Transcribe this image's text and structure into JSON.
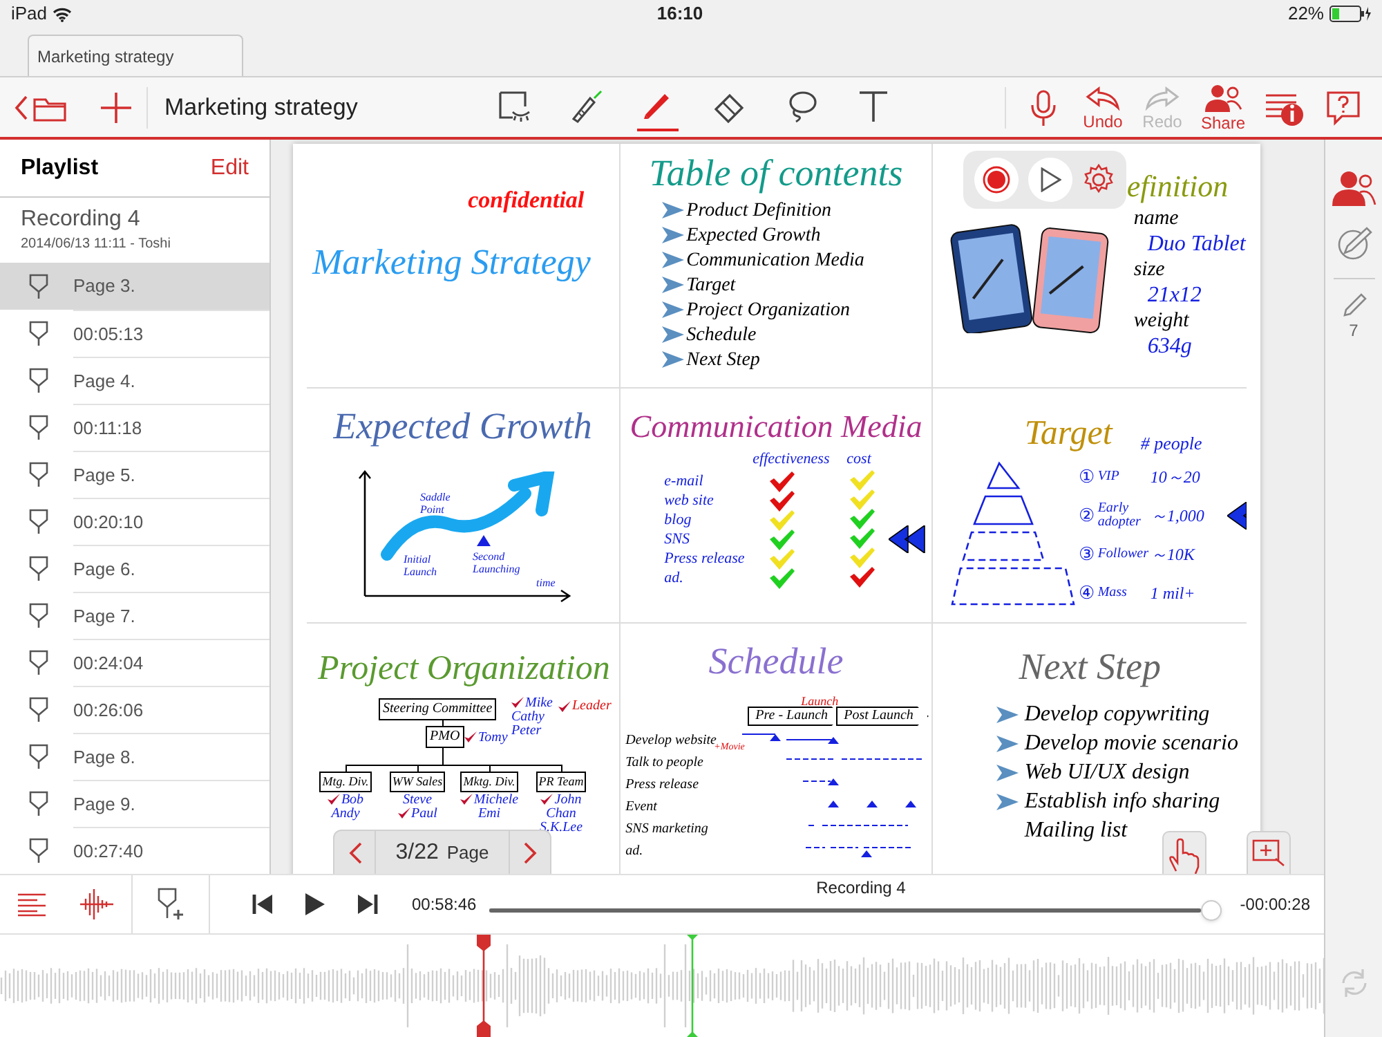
{
  "status_bar": {
    "device": "iPad",
    "time": "16:10",
    "battery": "22%"
  },
  "tabs": [
    {
      "label": "Marketing strategy",
      "selected": true
    }
  ],
  "toolbar": {
    "title": "Marketing strategy",
    "tools": [
      {
        "kind": "select",
        "selected": false
      },
      {
        "kind": "laser",
        "selected": false
      },
      {
        "kind": "pen",
        "selected": true
      },
      {
        "kind": "eraser",
        "selected": false
      },
      {
        "kind": "lasso",
        "selected": false
      },
      {
        "kind": "text",
        "selected": false
      }
    ],
    "actions": [
      {
        "kind": "mic",
        "disabled": false
      },
      {
        "kind": "undo",
        "label": "Undo",
        "disabled": false
      },
      {
        "kind": "redo",
        "label": "Redo",
        "disabled": true
      },
      {
        "kind": "share",
        "label": "Share",
        "disabled": false
      },
      {
        "kind": "info",
        "disabled": false
      },
      {
        "kind": "help",
        "disabled": false
      }
    ]
  },
  "playlist": {
    "title": "Playlist",
    "edit": "Edit",
    "recording": "Recording 4",
    "meta": "2014/06/13 11:11 - Toshi",
    "items": [
      {
        "label": "Page 3.",
        "selected": true
      },
      {
        "label": "00:05:13",
        "selected": false
      },
      {
        "label": "Page 4.",
        "selected": false
      },
      {
        "label": "00:11:18",
        "selected": false
      },
      {
        "label": "Page 5.",
        "selected": false
      },
      {
        "label": "00:20:10",
        "selected": false
      },
      {
        "label": "Page 6.",
        "selected": false
      },
      {
        "label": "Page 7.",
        "selected": false
      },
      {
        "label": "00:24:04",
        "selected": false
      },
      {
        "label": "00:26:06",
        "selected": false
      },
      {
        "label": "Page 8.",
        "selected": false
      },
      {
        "label": "Page 9.",
        "selected": false
      },
      {
        "label": "00:27:40",
        "selected": false
      }
    ]
  },
  "page": {
    "cells": [
      {
        "kind": "cover",
        "stamp": "confidential",
        "title": "Marketing Strategy"
      },
      {
        "kind": "bullets",
        "title": "Table of contents",
        "items": [
          {
            "text": "Product Definition",
            "bullet": true
          },
          {
            "text": "Expected Growth",
            "bullet": true
          },
          {
            "text": "Communication Media",
            "bullet": true
          },
          {
            "text": "Target",
            "bullet": true
          },
          {
            "text": "Project Organization",
            "bullet": true
          },
          {
            "text": "Schedule",
            "bullet": true
          },
          {
            "text": "Next Step",
            "bullet": true
          }
        ]
      },
      {
        "kind": "spec",
        "title": "efinition",
        "fields": [
          {
            "label": "name",
            "value": "Duo Tablet"
          },
          {
            "label": "size",
            "value": "21x12"
          },
          {
            "label": "weight",
            "value": "634g"
          }
        ]
      },
      {
        "kind": "growth",
        "title": "Expected Growth",
        "labels": [
          "Saddle Point",
          "Initial Launch",
          "Second Launching",
          "time"
        ]
      },
      {
        "kind": "matrix",
        "title": "Communication Media",
        "headers": [
          "effectiveness",
          "cost"
        ],
        "rows": [
          {
            "label": "e-mail",
            "arrow": false,
            "checks": [
              {
                "color": "#e01010"
              },
              {
                "color": "#f0e020"
              }
            ]
          },
          {
            "label": "web site",
            "arrow": false,
            "checks": [
              {
                "color": "#e01010"
              },
              {
                "color": "#f0e020"
              }
            ]
          },
          {
            "label": "blog",
            "arrow": false,
            "checks": [
              {
                "color": "#f0e020"
              },
              {
                "color": "#20d020"
              }
            ]
          },
          {
            "label": "SNS",
            "arrow": true,
            "checks": [
              {
                "color": "#20d020"
              },
              {
                "color": "#20d020"
              }
            ]
          },
          {
            "label": "Press release",
            "arrow": false,
            "checks": [
              {
                "color": "#f0e020"
              },
              {
                "color": "#f0e020"
              }
            ]
          },
          {
            "label": "ad.",
            "arrow": false,
            "checks": [
              {
                "color": "#20d020"
              },
              {
                "color": "#e01010"
              }
            ]
          }
        ]
      },
      {
        "kind": "target",
        "title": "Target",
        "header": "# people",
        "rows": [
          {
            "num": "①",
            "label": "VIP",
            "count": "10～20",
            "arrow": false
          },
          {
            "num": "②",
            "label": "Early adopter",
            "count": "～1,000",
            "arrow": true
          },
          {
            "num": "③",
            "label": "Follower",
            "count": "～10K",
            "arrow": false
          },
          {
            "num": "④",
            "label": "Mass",
            "count": "1 mil+",
            "arrow": false
          }
        ]
      },
      {
        "kind": "org",
        "title": "Project Organization",
        "top": "Steering Committee",
        "top_members": [
          {
            "name": "Mike",
            "leader": true
          },
          {
            "name": "Cathy",
            "leader": false
          },
          {
            "name": "Peter",
            "leader": false
          }
        ],
        "legend": "Leader",
        "pmo": "PMO",
        "pmo_members": [
          {
            "name": "Tomy",
            "leader": true
          }
        ],
        "divisions": [
          {
            "name": "Mtg. Div.",
            "members": [
              {
                "name": "Bob",
                "leader": true
              },
              {
                "name": "Andy",
                "leader": false
              }
            ]
          },
          {
            "name": "WW Sales",
            "members": [
              {
                "name": "Steve",
                "leader": false
              },
              {
                "name": "Paul",
                "leader": true
              }
            ]
          },
          {
            "name": "Mktg. Div.",
            "members": [
              {
                "name": "Michele",
                "leader": true
              },
              {
                "name": "Emi",
                "leader": false
              }
            ]
          },
          {
            "name": "PR Team",
            "members": [
              {
                "name": "John",
                "leader": true
              },
              {
                "name": "Chan",
                "leader": false
              },
              {
                "name": "S.K.Lee",
                "leader": false
              }
            ]
          }
        ]
      },
      {
        "kind": "schedule",
        "title": "Schedule",
        "phases": [
          "Pre - Launch",
          "Post Launch"
        ],
        "milestone": "Launch",
        "tasks": [
          {
            "text": "Develop website",
            "note": "+Movie"
          },
          {
            "text": "Talk to people"
          },
          {
            "text": "Press release"
          },
          {
            "text": "Event"
          },
          {
            "text": "SNS marketing"
          },
          {
            "text": "ad."
          }
        ]
      },
      {
        "kind": "bullets",
        "title": "Next Step",
        "items": [
          {
            "text": "Develop copywriting",
            "bullet": true
          },
          {
            "text": "Develop movie scenario",
            "bullet": true
          },
          {
            "text": "Web UI/UX design",
            "bullet": true
          },
          {
            "text": "Establish info sharing",
            "bullet": true
          },
          {
            "text": "Mailing list",
            "bullet": false
          }
        ]
      }
    ]
  },
  "page_nav": {
    "current": "3/22",
    "label": "Page"
  },
  "right_rail": {
    "pen_count": "7"
  },
  "player": {
    "title": "Recording 4",
    "elapsed": "00:58:46",
    "remaining": "-00:00:28",
    "level": 0.985
  }
}
